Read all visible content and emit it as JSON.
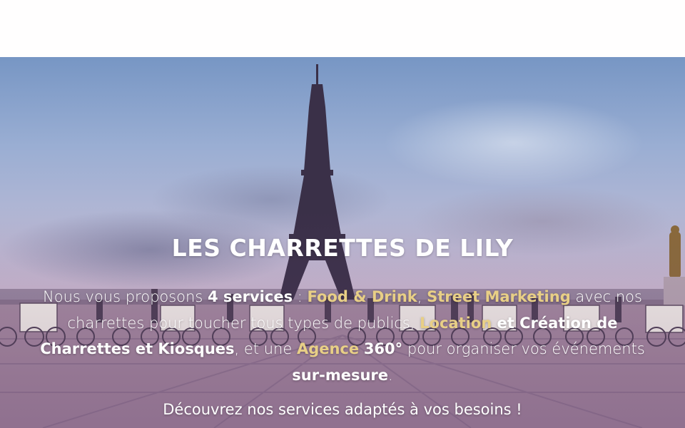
{
  "hero": {
    "title": "LES CHARRETTES DE LILY",
    "intro_1": "Nous vous proposons ",
    "services_count": "4 services",
    "sep_1": " : ",
    "link_food": "Food & Drink",
    "sep_2": ", ",
    "link_street": "Street Marketing",
    "text_2": " avec nos charrettes pour toucher tous types de publics, ",
    "link_location": "Location",
    "and_1": " et ",
    "creation": "Création de Charrettes et Kiosques",
    "text_3": ", et une ",
    "link_agence": "Agence",
    "space": " ",
    "agence_360": "360°",
    "text_4": " pour organiser vos événements ",
    "sur_mesure": "sur-mesure",
    "period": ".",
    "cta": "Découvrez nos services adaptés à vos besoins !"
  },
  "colors": {
    "accent_gold": "#e8cf86",
    "text_white": "#ffffff",
    "top_bar": "#fffefe"
  }
}
